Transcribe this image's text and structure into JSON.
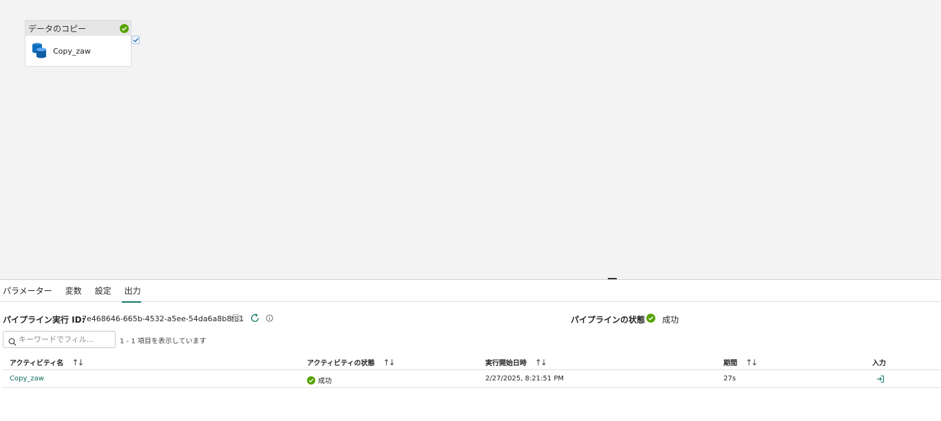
{
  "canvas": {
    "activity": {
      "type_label": "データのコピー",
      "name": "Copy_zaw"
    }
  },
  "tabs": [
    {
      "label": "パラメーター"
    },
    {
      "label": "変数"
    },
    {
      "label": "設定"
    },
    {
      "label": "出力",
      "active": true
    }
  ],
  "run": {
    "id_label": "パイプライン実行 ID:",
    "id_value": "7e468646-665b-4532-a5ee-54da6a8b8f81",
    "status_label": "パイプラインの状態",
    "status_value": "成功"
  },
  "filter": {
    "placeholder": "キーワードでフィル...",
    "count_text": "1 - 1 項目を表示しています"
  },
  "table": {
    "columns": [
      "アクティビティ名",
      "アクティビティの状態",
      "実行開始日時",
      "期間",
      "入力"
    ],
    "rows": [
      {
        "name": "Copy_zaw",
        "status": "成功",
        "start": "2/27/2025, 8:21:51 PM",
        "duration": "27s",
        "input_icon": "input-icon"
      }
    ]
  },
  "colors": {
    "success": "#57a300",
    "accent": "#117865",
    "link": "#0f6b5c"
  }
}
